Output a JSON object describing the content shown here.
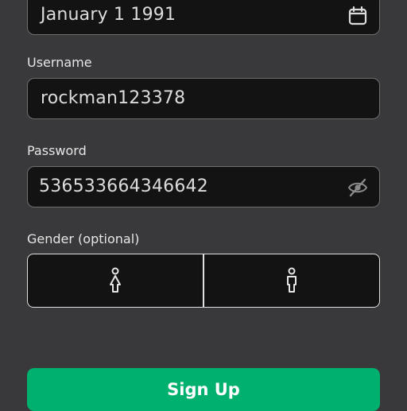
{
  "birthday": {
    "value": "January 1 1991",
    "icon": "calendar-icon"
  },
  "username": {
    "label": "Username",
    "value": "rockman123378"
  },
  "password": {
    "label": "Password",
    "value": "536533664346642",
    "icon": "eye-off-icon"
  },
  "gender": {
    "label": "Gender (optional)",
    "options": [
      {
        "icon": "female-icon"
      },
      {
        "icon": "male-icon"
      }
    ]
  },
  "signup": {
    "label": "Sign Up"
  },
  "colors": {
    "background": "#39393b",
    "field_background": "#131313",
    "accent": "#00b06f"
  }
}
